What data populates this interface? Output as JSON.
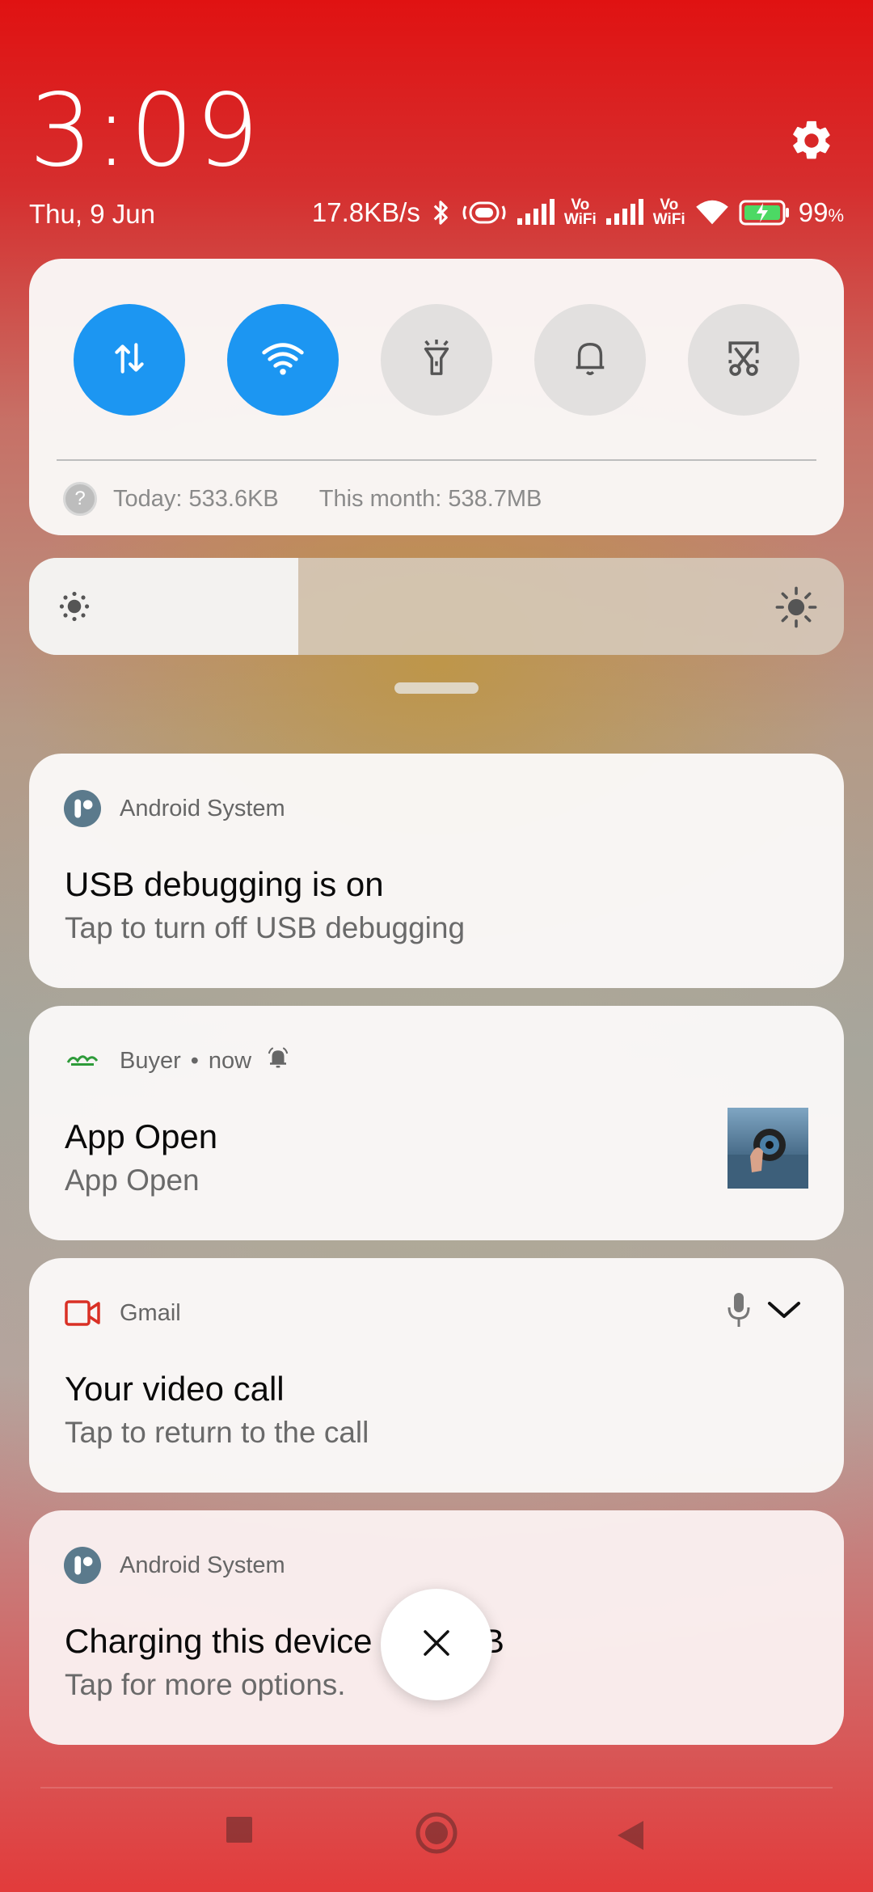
{
  "header": {
    "time": "3:09",
    "date": "Thu, 9 Jun",
    "net_speed": "17.8KB/s",
    "vowifi_top": "Vo",
    "vowifi_bottom": "WiFi",
    "battery": "99",
    "battery_unit": "%"
  },
  "quick_settings": {
    "toggles": [
      {
        "name": "mobile-data",
        "icon": "mobile-data-icon",
        "on": true
      },
      {
        "name": "wifi",
        "icon": "wifi-icon",
        "on": true
      },
      {
        "name": "flashlight",
        "icon": "flashlight-icon",
        "on": false
      },
      {
        "name": "ringer",
        "icon": "bell-icon",
        "on": false
      },
      {
        "name": "screenshot",
        "icon": "screenshot-scissors-icon",
        "on": false
      }
    ],
    "usage_today": "Today: 533.6KB",
    "usage_month": "This month: 538.7MB"
  },
  "brightness": {
    "level": 0.33
  },
  "notifications": [
    {
      "app": "Android System",
      "title": "USB debugging is on",
      "text": "Tap to turn off USB debugging"
    },
    {
      "app": "Buyer",
      "separator": "•",
      "time": "now",
      "title": "App Open",
      "text": "App Open"
    },
    {
      "app": "Gmail",
      "title": "Your video call",
      "text": "Tap to return to the call"
    },
    {
      "app": "Android System",
      "title": "Charging this device via USB",
      "text": "Tap for more options."
    }
  ],
  "colors": {
    "accent": "#1c96f2",
    "gmail_red": "#d93025",
    "android_icon": "#5b7a8c"
  }
}
